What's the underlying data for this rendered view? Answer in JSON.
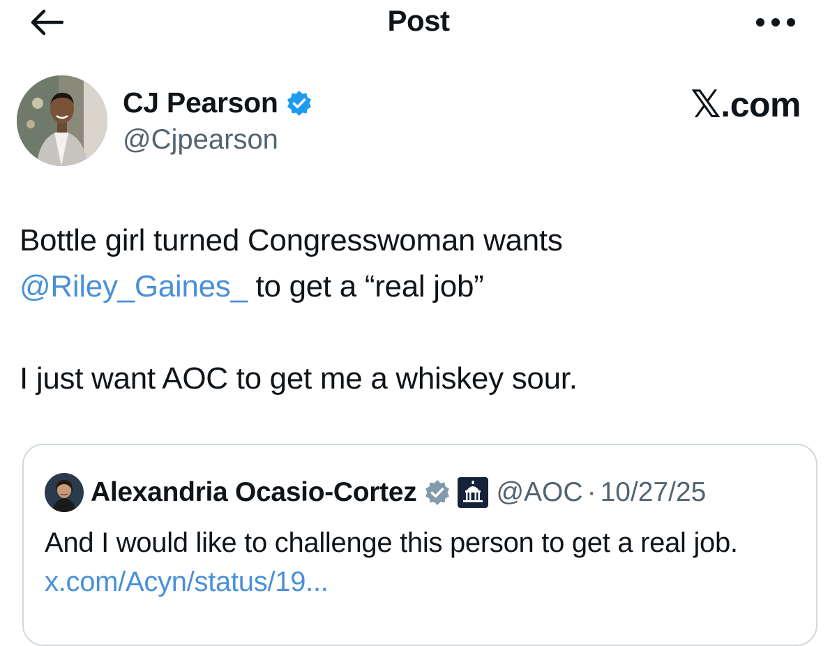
{
  "header": {
    "title": "Post",
    "back_icon": "arrow-left-icon",
    "more_icon": "more-horizontal-icon"
  },
  "author": {
    "display_name": "CJ Pearson",
    "handle": "@Cjpearson",
    "verified_icon": "verified-badge-icon",
    "verified_color": "#1d9bf0"
  },
  "brand": {
    "x_glyph": "𝕏",
    "suffix": ".com"
  },
  "post": {
    "line1": "Bottle girl turned Congresswoman wants",
    "mention": "@Riley_Gaines_",
    "line2_rest": " to get a “real job”",
    "line3": "I just want AOC to get me a whiskey sour."
  },
  "quote": {
    "display_name": "Alexandria Ocasio-Cortez",
    "verified_icon": "gray-verified-badge-icon",
    "verified_color": "#829aab",
    "affiliation_icon": "capitol-affiliation-icon",
    "handle": "@AOC",
    "separator": "·",
    "date": "10/27/25",
    "text": "And I would like to challenge this person to get a real job.",
    "link": "x.com/Acyn/status/19..."
  },
  "colors": {
    "link": "#4a90d9",
    "secondary_text": "#536471",
    "border": "#cfd9de"
  }
}
